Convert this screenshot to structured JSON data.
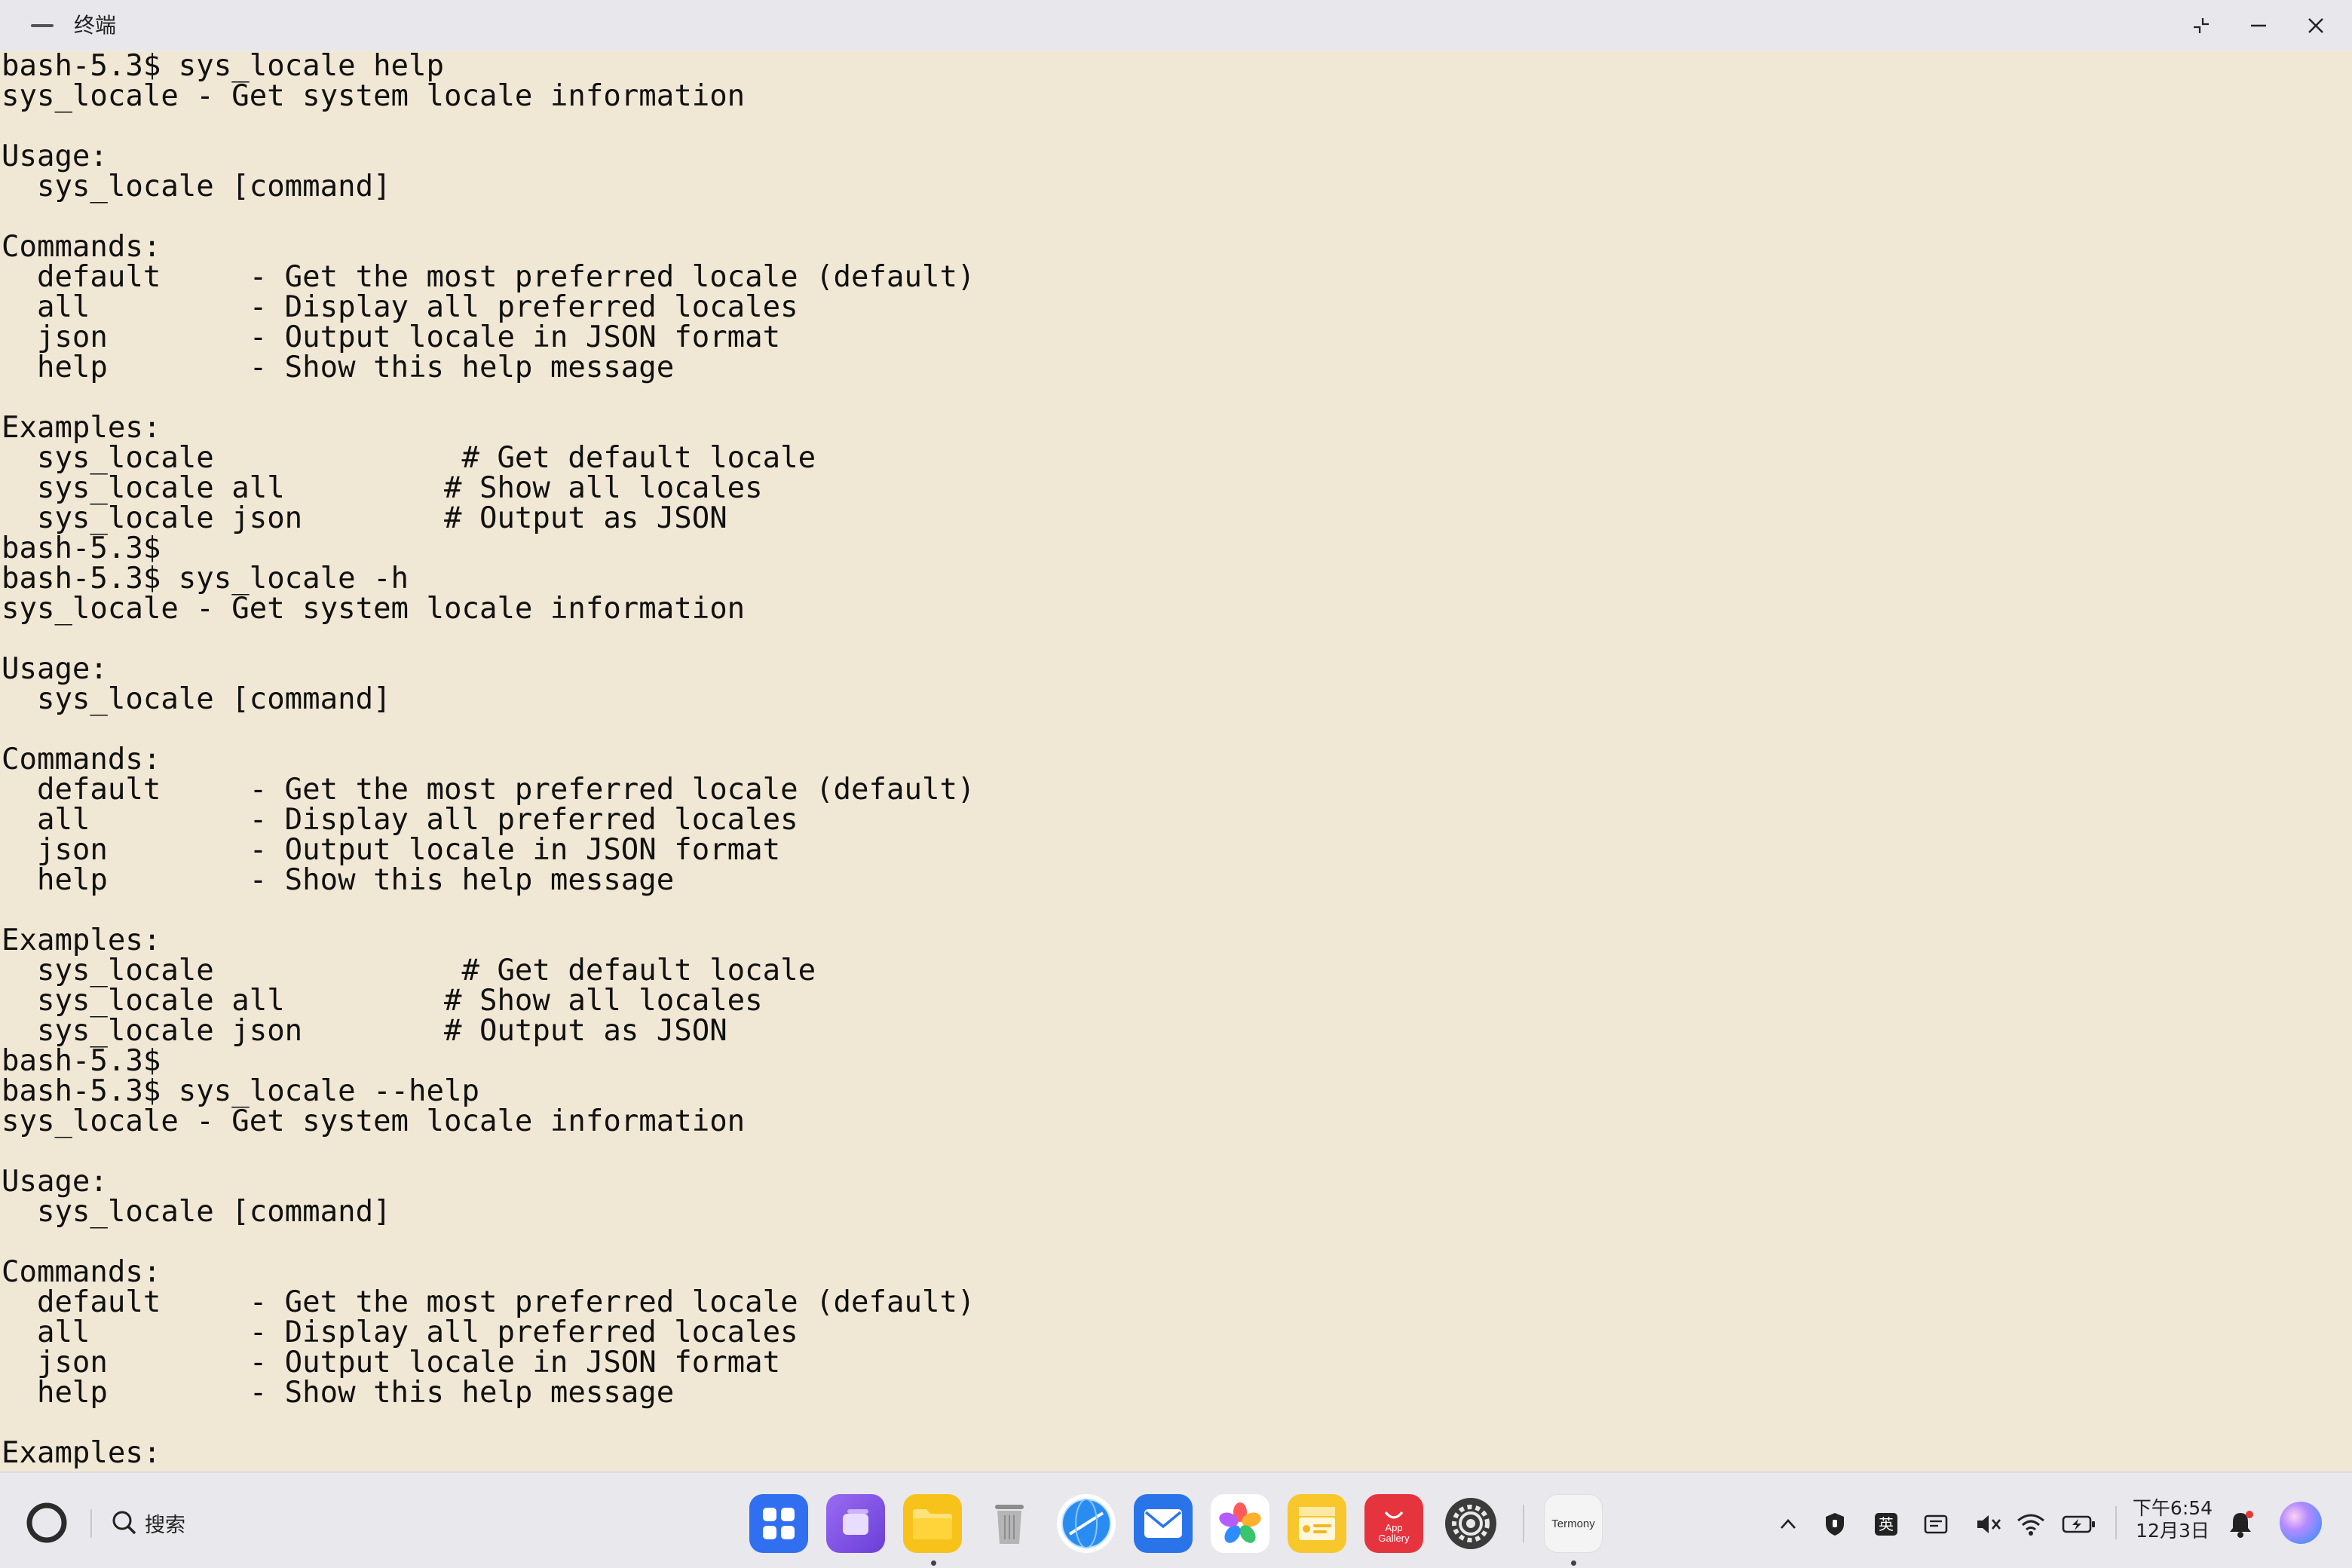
{
  "window": {
    "title": "终端",
    "app_icon_label": "Termony"
  },
  "terminal": {
    "lines": [
      "bash-5.3$ sys_locale help",
      "sys_locale - Get system locale information",
      "",
      "Usage:",
      "  sys_locale [command]",
      "",
      "Commands:",
      "  default     - Get the most preferred locale (default)",
      "  all         - Display all preferred locales",
      "  json        - Output locale in JSON format",
      "  help        - Show this help message",
      "",
      "Examples:",
      "  sys_locale              # Get default locale",
      "  sys_locale all         # Show all locales",
      "  sys_locale json        # Output as JSON",
      "bash-5.3$",
      "bash-5.3$ sys_locale -h",
      "sys_locale - Get system locale information",
      "",
      "Usage:",
      "  sys_locale [command]",
      "",
      "Commands:",
      "  default     - Get the most preferred locale (default)",
      "  all         - Display all preferred locales",
      "  json        - Output locale in JSON format",
      "  help        - Show this help message",
      "",
      "Examples:",
      "  sys_locale              # Get default locale",
      "  sys_locale all         # Show all locales",
      "  sys_locale json        # Output as JSON",
      "bash-5.3$",
      "bash-5.3$ sys_locale --help",
      "sys_locale - Get system locale information",
      "",
      "Usage:",
      "  sys_locale [command]",
      "",
      "Commands:",
      "  default     - Get the most preferred locale (default)",
      "  all         - Display all preferred locales",
      "  json        - Output locale in JSON format",
      "  help        - Show this help message",
      "",
      "Examples:"
    ]
  },
  "taskbar": {
    "search_label": "搜索",
    "dock": [
      {
        "name": "app-launcher",
        "color": "#2f6ff0"
      },
      {
        "name": "multitask",
        "color": "#7a55e0"
      },
      {
        "name": "files",
        "color": "#f7c21a"
      },
      {
        "name": "trash",
        "color": "#9a9a9a"
      },
      {
        "name": "browser",
        "color": "#1e7be6"
      },
      {
        "name": "mail",
        "color": "#2a74ea"
      },
      {
        "name": "photos",
        "color": "#ff6f52"
      },
      {
        "name": "notes",
        "color": "#f7c72b"
      },
      {
        "name": "app-gallery",
        "color": "#e6343f"
      },
      {
        "name": "settings",
        "color": "#3a3a3a"
      },
      {
        "name": "termony",
        "color": "#f4f4f4"
      }
    ],
    "app_gallery_label_1": "App",
    "app_gallery_label_2": "Gallery",
    "termony_label": "Termony",
    "ime_label": "英",
    "clock_time": "下午6:54",
    "clock_date": "12月3日"
  }
}
